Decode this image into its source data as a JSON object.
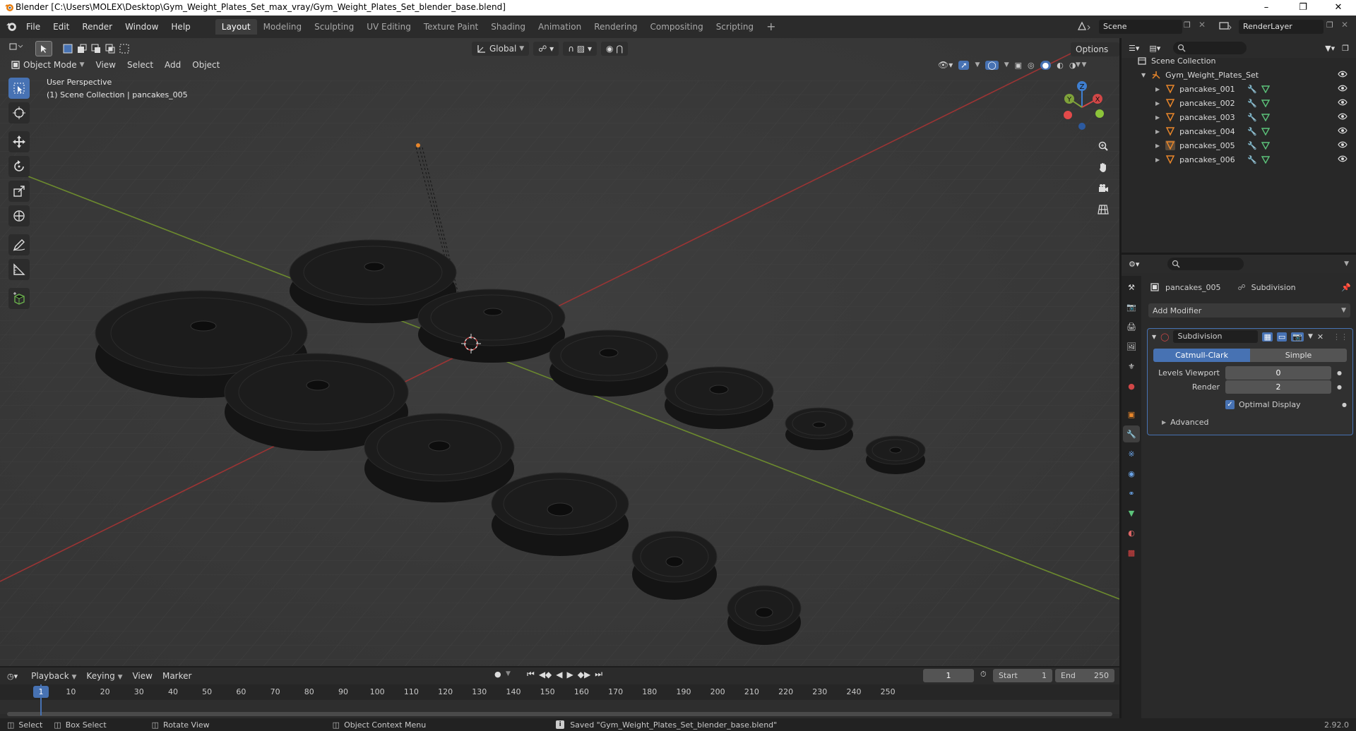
{
  "window": {
    "title": "Blender [C:\\Users\\MOLEX\\Desktop\\Gym_Weight_Plates_Set_max_vray/Gym_Weight_Plates_Set_blender_base.blend]"
  },
  "menu": [
    "File",
    "Edit",
    "Render",
    "Window",
    "Help"
  ],
  "workspaces": [
    "Layout",
    "Modeling",
    "Sculpting",
    "UV Editing",
    "Texture Paint",
    "Shading",
    "Animation",
    "Rendering",
    "Compositing",
    "Scripting"
  ],
  "top_right": {
    "scene": "Scene",
    "render_layer": "RenderLayer"
  },
  "viewport": {
    "mode": "Object Mode",
    "menus": [
      "View",
      "Select",
      "Add",
      "Object"
    ],
    "orientation": "Global",
    "options_label": "Options",
    "perspective": "User Perspective",
    "context": "(1) Scene Collection | pancakes_005",
    "gizmo": {
      "x": "X",
      "y": "Y",
      "z": "Z"
    }
  },
  "outliner": {
    "root": "Scene Collection",
    "collection": "Gym_Weight_Plates_Set",
    "objects": [
      "pancakes_001",
      "pancakes_002",
      "pancakes_003",
      "pancakes_004",
      "pancakes_005",
      "pancakes_006"
    ]
  },
  "properties": {
    "object": "pancakes_005",
    "modifier_context": "Subdivision",
    "add_modifier": "Add Modifier",
    "modifier": {
      "name": "Subdivision",
      "type_options": [
        "Catmull-Clark",
        "Simple"
      ],
      "selected_type": "Catmull-Clark",
      "levels_viewport_label": "Levels Viewport",
      "levels_viewport": "0",
      "render_label": "Render",
      "render": "2",
      "optimal_display_label": "Optimal Display",
      "optimal_display": true,
      "advanced_label": "Advanced"
    }
  },
  "timeline": {
    "menus": [
      "Playback",
      "Keying",
      "View",
      "Marker"
    ],
    "current_frame": "1",
    "start_label": "Start",
    "start": "1",
    "end_label": "End",
    "end": "250",
    "ruler": [
      "1",
      "10",
      "20",
      "30",
      "40",
      "50",
      "60",
      "70",
      "80",
      "90",
      "100",
      "110",
      "120",
      "130",
      "140",
      "150",
      "160",
      "170",
      "180",
      "190",
      "200",
      "210",
      "220",
      "230",
      "240",
      "250"
    ]
  },
  "status": {
    "select": "Select",
    "box_select": "Box Select",
    "rotate_view": "Rotate View",
    "context_menu": "Object Context Menu",
    "message": "Saved \"Gym_Weight_Plates_Set_blender_base.blend\"",
    "version": "2.92.0"
  },
  "colors": {
    "accent": "#4772b3",
    "viewport_bg": "#3a3a3a",
    "x_axis": "#b83a3a",
    "y_axis": "#7fa23a",
    "object_orange": "#e8862a"
  }
}
